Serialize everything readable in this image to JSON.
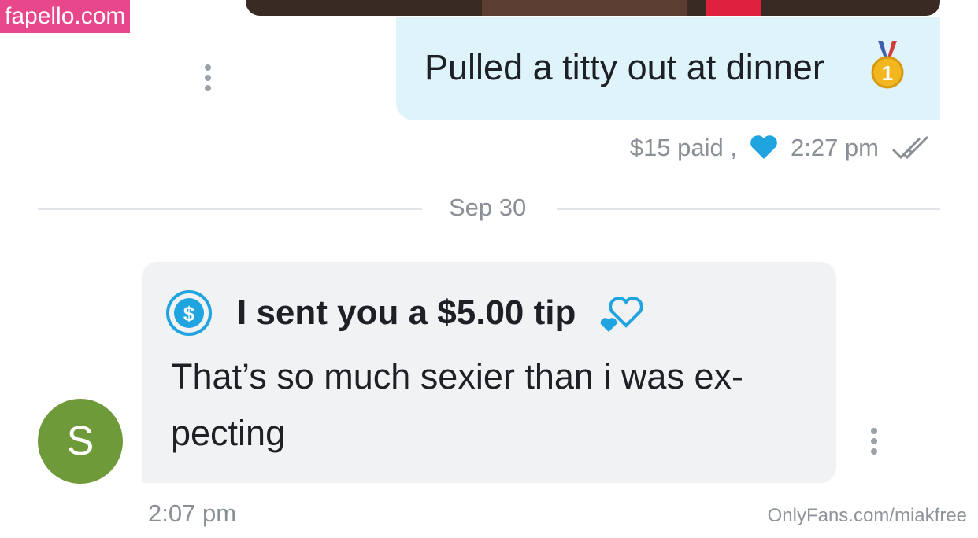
{
  "watermark": {
    "top": "fapello.com",
    "bottom": "OnlyFans.com/miakfree"
  },
  "sent_message": {
    "text": "Pulled a titty out at dinner",
    "emoji_icon": "first-place-medal-icon",
    "price_status": "$15 paid ,",
    "time": "2:27 pm",
    "liked_icon": "heart-icon",
    "read_icon": "double-check-icon"
  },
  "date_separator": "Sep 30",
  "received_message": {
    "avatar_letter": "S",
    "tip_label": "I sent you a $5.00 tip",
    "tip_icon": "dollar-circle-icon",
    "tip_decoration_icon": "hearts-icon",
    "text": "That’s so much sexier than i was ex-pecting",
    "time": "2:07 pm"
  },
  "colors": {
    "sent_bubble": "#dff3fb",
    "received_bubble": "#f0f2f4",
    "accent_blue": "#1fa4e0",
    "avatar_green": "#6f9a3a",
    "watermark_pink": "#e8478b"
  }
}
